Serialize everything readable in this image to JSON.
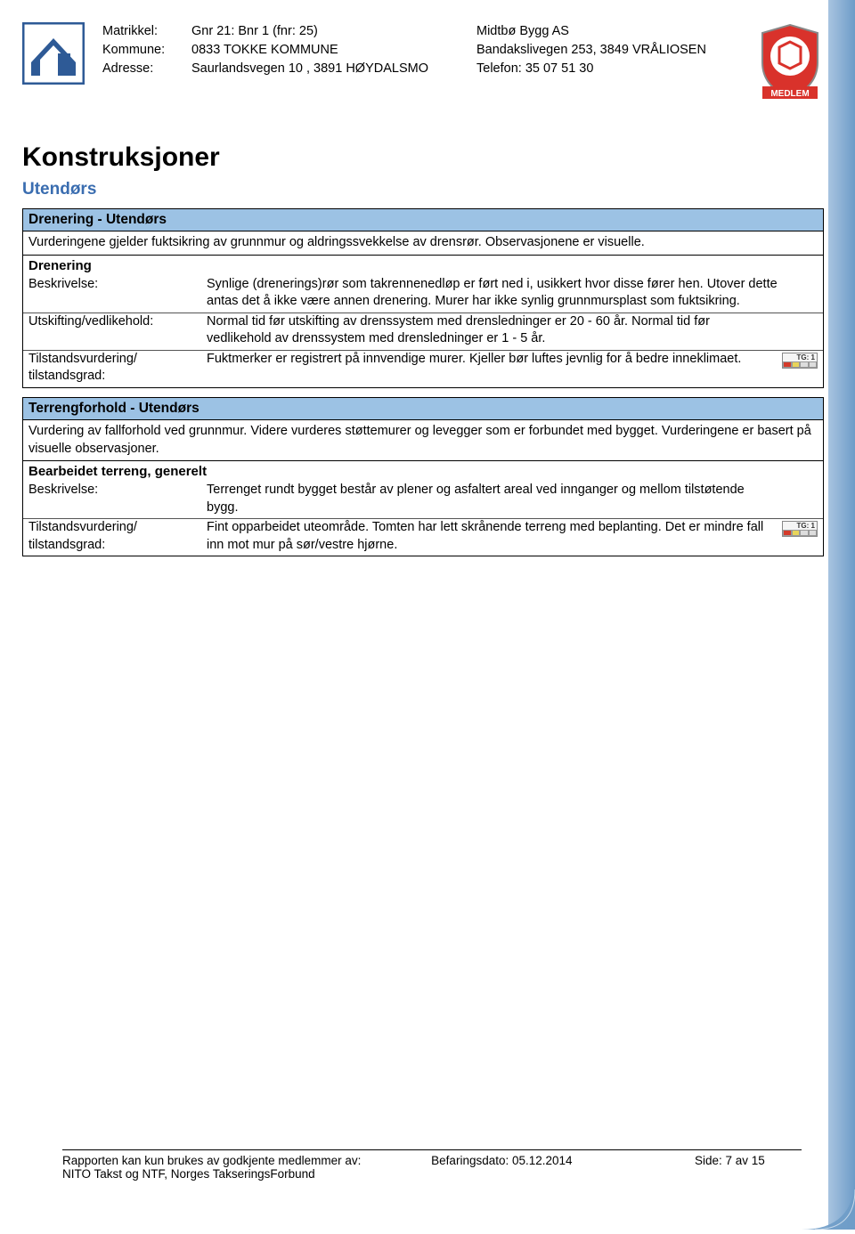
{
  "header": {
    "labels": {
      "matrikkel": "Matrikkel:",
      "kommune": "Kommune:",
      "adresse": "Adresse:"
    },
    "matrikkel": "Gnr 21: Bnr 1 (fnr: 25)",
    "kommune": "0833 TOKKE KOMMUNE",
    "adresse": "Saurlandsvegen 10 , 3891 HØYDALSMO",
    "company": "Midtbø Bygg AS",
    "company_addr": "Bandakslivegen 253, 3849 VRÅLIOSEN",
    "company_tel": "Telefon: 35 07 51 30",
    "medlem": "MEDLEM"
  },
  "main_title": "Konstruksjoner",
  "subtitle": "Utendørs",
  "section1": {
    "title": "Drenering - Utendørs",
    "desc": "Vurderingene gjelder fuktsikring av grunnmur og aldringssvekkelse av drensrør. Observasjonene er visuelle.",
    "sub_title": "Drenering",
    "rows": {
      "beskrivelse_label": "Beskrivelse:",
      "beskrivelse_value": "Synlige (drenerings)rør som takrennenedløp er ført ned i, usikkert hvor disse fører hen. Utover dette antas det å ikke være annen drenering. Murer har ikke synlig grunnmursplast som fuktsikring.",
      "utskifting_label": "Utskifting/vedlikehold:",
      "utskifting_value": "Normal tid før utskifting av drenssystem med drensledninger er 20 - 60 år. Normal tid før vedlikehold av drenssystem med drensledninger er 1 - 5 år.",
      "tilstand_label": "Tilstandsvurdering/ tilstandsgrad:",
      "tilstand_value": "Fuktmerker er registrert på innvendige murer. Kjeller bør luftes jevnlig for å bedre inneklimaet.",
      "tg": "TG: 1"
    }
  },
  "section2": {
    "title": "Terrengforhold - Utendørs",
    "desc": "Vurdering av fallforhold ved grunnmur. Videre vurderes støttemurer og levegger som er forbundet med bygget. Vurderingene er basert på visuelle observasjoner.",
    "sub_title": "Bearbeidet terreng, generelt",
    "rows": {
      "beskrivelse_label": "Beskrivelse:",
      "beskrivelse_value": "Terrenget rundt bygget består av plener og asfaltert areal ved innganger og mellom tilstøtende bygg.",
      "tilstand_label": "Tilstandsvurdering/ tilstandsgrad:",
      "tilstand_value": "Fint opparbeidet uteområde. Tomten har lett skrånende terreng med beplanting. Det er mindre fall inn mot mur på sør/vestre hjørne.",
      "tg": "TG: 1"
    }
  },
  "footer": {
    "line1": "Rapporten kan kun brukes av godkjente medlemmer av:",
    "line2": "NITO Takst og NTF, Norges TakseringsForbund",
    "befaring_label": "Befaringsdato:",
    "befaring_value": "05.12.2014",
    "side": "Side: 7 av 15"
  }
}
